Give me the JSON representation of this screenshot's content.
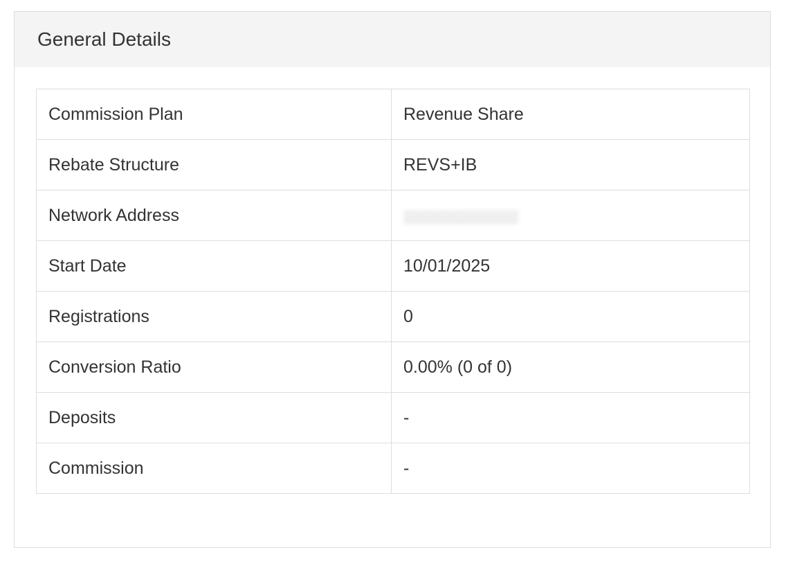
{
  "panel": {
    "title": "General Details"
  },
  "rows": [
    {
      "label": "Commission Plan",
      "value": "Revenue Share"
    },
    {
      "label": "Rebate Structure",
      "value": "REVS+IB"
    },
    {
      "label": "Network Address",
      "value": "",
      "value_obscured": true
    },
    {
      "label": "Start Date",
      "value": "10/01/2025"
    },
    {
      "label": "Registrations",
      "value": "0"
    },
    {
      "label": "Conversion Ratio",
      "value": "0.00% (0 of 0)"
    },
    {
      "label": "Deposits",
      "value": "-"
    },
    {
      "label": "Commission",
      "value": "-"
    }
  ],
  "colors": {
    "header_background": "#f4f4f4",
    "border": "#dddddd",
    "text": "#333333"
  }
}
